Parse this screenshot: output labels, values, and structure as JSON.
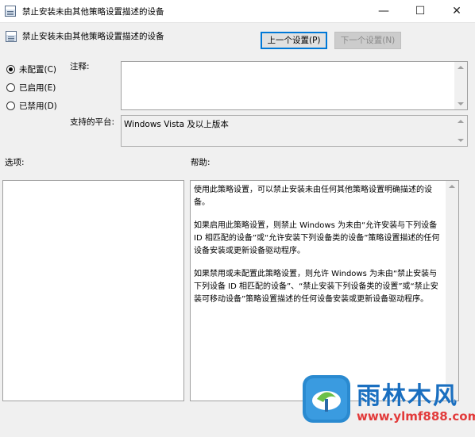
{
  "window": {
    "title": "禁止安装未由其他策略设置描述的设备",
    "controls": [
      "minimize-icon",
      "maximize-icon",
      "close-icon"
    ]
  },
  "header": {
    "policy_name": "禁止安装未由其他策略设置描述的设备",
    "prev_button": "上一个设置(P)",
    "next_button": "下一个设置(N)"
  },
  "state": {
    "options": [
      {
        "label": "未配置(C)",
        "checked": true
      },
      {
        "label": "已启用(E)",
        "checked": false
      },
      {
        "label": "已禁用(D)",
        "checked": false
      }
    ]
  },
  "comment": {
    "label": "注释:",
    "value": ""
  },
  "platform": {
    "label": "支持的平台:",
    "value": "Windows Vista 及以上版本"
  },
  "options_panel": {
    "label": "选项:"
  },
  "help_panel": {
    "label": "帮助:",
    "paragraphs": [
      "使用此策略设置，可以禁止安装未由任何其他策略设置明确描述的设备。",
      "如果启用此策略设置，则禁止 Windows 为未由“允许安装与下列设备 ID 相匹配的设备”或“允许安装下列设备类的设备”策略设置描述的任何设备安装或更新设备驱动程序。",
      "如果禁用或未配置此策略设置，则允许 Windows 为未由“禁止安装与下列设备 ID 相匹配的设备”、“禁止安装下列设备类的设置”或“禁止安装可移动设备”策略设置描述的任何设备安装或更新设备驱动程序。"
    ]
  },
  "watermark": {
    "brand": "雨林木风",
    "url": "www.ylmf888.com"
  },
  "colors": {
    "accent": "#0078d7",
    "brand_blue": "#1a6fc0",
    "brand_red": "#e23a3a"
  }
}
